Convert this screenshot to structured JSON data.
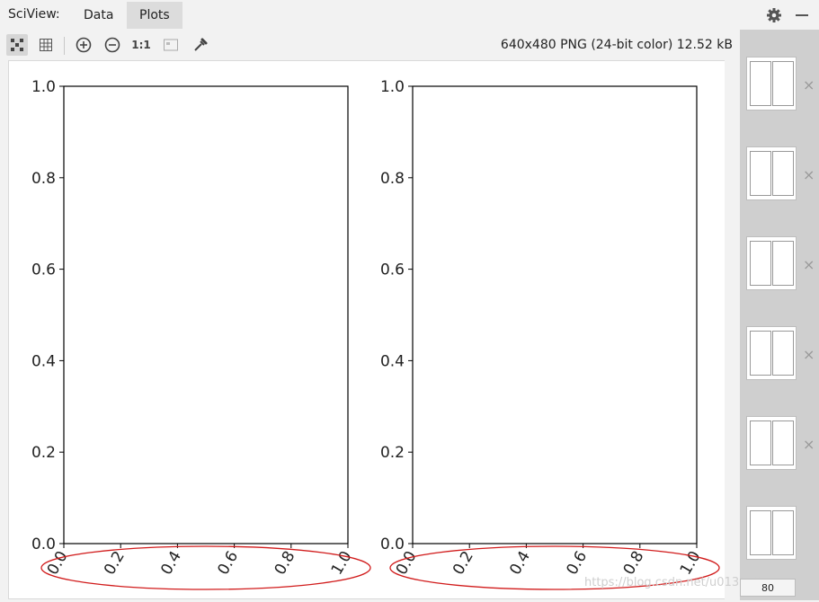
{
  "header": {
    "app_title": "SciView:",
    "tabs": [
      {
        "label": "Data"
      },
      {
        "label": "Plots"
      }
    ],
    "active_tab": "Plots",
    "icons": [
      "gear-icon",
      "minimize-icon"
    ]
  },
  "toolbar": {
    "info": "640x480 PNG (24-bit color) 12.52 kB",
    "icons": [
      "grid-dots-icon",
      "table-icon",
      "zoom-in-icon",
      "zoom-out-icon",
      "actual-size-icon",
      "fit-icon",
      "eyedropper-icon"
    ],
    "actual_size_label": "1:1"
  },
  "chart_data": [
    {
      "type": "line",
      "title": "",
      "xlabel": "",
      "ylabel": "",
      "xlim": [
        0.0,
        1.0
      ],
      "ylim": [
        0.0,
        1.0
      ],
      "x_ticks": [
        "0.0",
        "0.2",
        "0.4",
        "0.6",
        "0.8",
        "1.0"
      ],
      "y_ticks": [
        "0.0",
        "0.2",
        "0.4",
        "0.6",
        "0.8",
        "1.0"
      ],
      "series": [],
      "annotations": [
        {
          "kind": "red-ellipse",
          "around": "x-tick-labels"
        }
      ]
    },
    {
      "type": "line",
      "title": "",
      "xlabel": "",
      "ylabel": "",
      "xlim": [
        0.0,
        1.0
      ],
      "ylim": [
        0.0,
        1.0
      ],
      "x_ticks": [
        "0.0",
        "0.2",
        "0.4",
        "0.6",
        "0.8",
        "1.0"
      ],
      "y_ticks": [
        "0.0",
        "0.2",
        "0.4",
        "0.6",
        "0.8",
        "1.0"
      ],
      "series": [],
      "annotations": [
        {
          "kind": "red-ellipse",
          "around": "x-tick-labels"
        }
      ]
    }
  ],
  "sidebar": {
    "thumbnails": [
      {
        "id": 1
      },
      {
        "id": 2
      },
      {
        "id": 3
      },
      {
        "id": 4
      },
      {
        "id": 5
      },
      {
        "id": 6
      }
    ],
    "page_badge": "80",
    "close_label": "×"
  },
  "watermark": "https://blog.csdn.net/u013062626",
  "colors": {
    "annotation": "#d11b1b",
    "active_tab": "#dcdcdc",
    "sidebar": "#cfcfcf"
  }
}
